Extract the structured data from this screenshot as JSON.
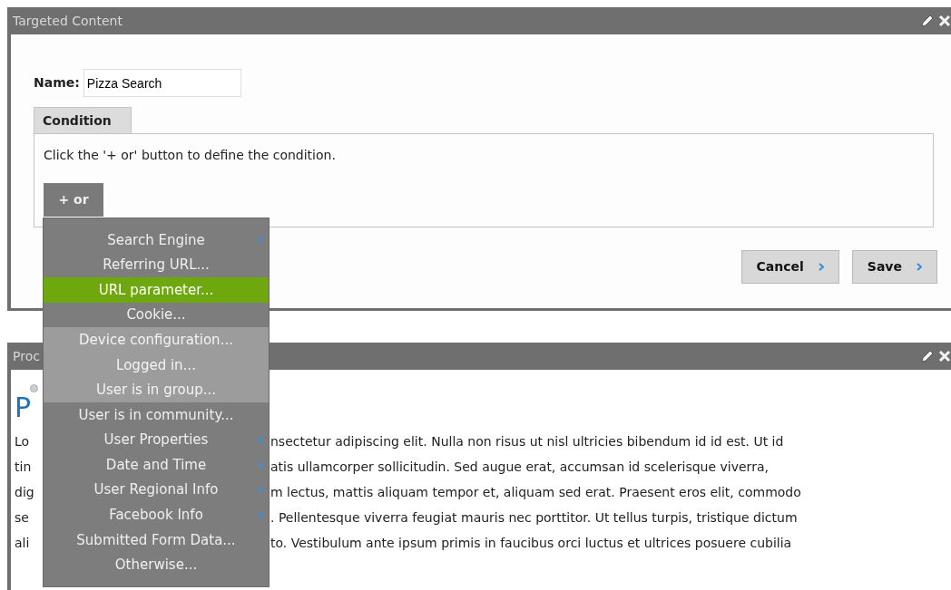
{
  "targeting_panel": {
    "title": "Targeted Content",
    "name_label": "Name:",
    "name_value": "Pizza Search",
    "condition_tab": "Condition",
    "hint": "Click the '+ or' button to define the condition.",
    "add_button": "+ or",
    "buttons": [
      "Cancel",
      "Save"
    ]
  },
  "condition_menu": [
    {
      "label": "Search Engine",
      "submenu": true,
      "selected": false,
      "hovered": false
    },
    {
      "label": "Referring URL...",
      "submenu": false,
      "selected": false,
      "hovered": false
    },
    {
      "label": "URL parameter...",
      "submenu": false,
      "selected": true,
      "hovered": false
    },
    {
      "label": "Cookie...",
      "submenu": false,
      "selected": false,
      "hovered": false
    },
    {
      "label": "Device configuration...",
      "submenu": false,
      "selected": false,
      "hovered": true
    },
    {
      "label": "Logged in...",
      "submenu": false,
      "selected": false,
      "hovered": true
    },
    {
      "label": "User is in group...",
      "submenu": false,
      "selected": false,
      "hovered": true
    },
    {
      "label": "User is in community...",
      "submenu": false,
      "selected": false,
      "hovered": false
    },
    {
      "label": "User Properties",
      "submenu": true,
      "selected": false,
      "hovered": false
    },
    {
      "label": "Date and Time",
      "submenu": true,
      "selected": false,
      "hovered": false
    },
    {
      "label": "User Regional Info",
      "submenu": true,
      "selected": false,
      "hovered": false
    },
    {
      "label": "Facebook Info",
      "submenu": true,
      "selected": false,
      "hovered": false
    },
    {
      "label": "Submitted Form Data...",
      "submenu": false,
      "selected": false,
      "hovered": false
    },
    {
      "label": "Otherwise...",
      "submenu": false,
      "selected": false,
      "hovered": false
    }
  ],
  "content_panel": {
    "title": "Proc",
    "heading": "P",
    "body_lines": [
      {
        "left": "Lo",
        "right": "nsectetur adipiscing elit. Nulla non risus ut nisl ultricies bibendum id id est. Ut id"
      },
      {
        "left": "tin",
        "right": "atis ullamcorper sollicitudin. Sed augue erat, accumsan id scelerisque viverra,"
      },
      {
        "left": "dig",
        "right": "m lectus, mattis aliquam tempor et, aliquam sed erat. Praesent eros elit, commodo"
      },
      {
        "left": "se",
        "right": ". Pellentesque viverra feugiat mauris nec porttitor. Ut tellus turpis, tristique dictum"
      },
      {
        "left": "ali",
        "right": "to. Vestibulum ante ipsum primis in faucibus orci luctus et ultrices posuere cubilia"
      }
    ]
  }
}
